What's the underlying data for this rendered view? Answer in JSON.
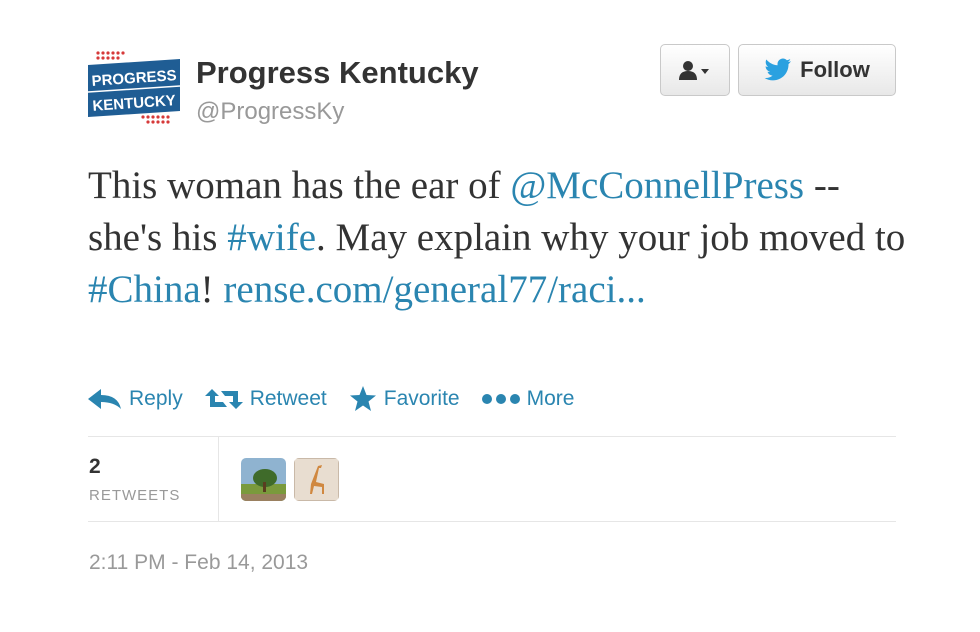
{
  "account": {
    "name": "Progress Kentucky",
    "screen_name": "@ProgressKy",
    "logo_text": [
      "PROGRESS",
      "KENTUCKY"
    ]
  },
  "buttons": {
    "follow_label": "Follow"
  },
  "tweet": {
    "segments": [
      {
        "text": "This woman has the ear of ",
        "type": "text"
      },
      {
        "text": "@McConnellPress",
        "type": "mention"
      },
      {
        "text": " -- she's his ",
        "type": "text"
      },
      {
        "text": "#wife",
        "type": "hashtag"
      },
      {
        "text": ". May explain why your job moved to ",
        "type": "text"
      },
      {
        "text": "#China",
        "type": "hashtag"
      },
      {
        "text": "! ",
        "type": "text"
      },
      {
        "text": "rense.com/general77/raci...",
        "type": "url"
      }
    ]
  },
  "actions": [
    {
      "label": "Reply",
      "icon": "reply-icon"
    },
    {
      "label": "Retweet",
      "icon": "retweet-icon"
    },
    {
      "label": "Favorite",
      "icon": "star-icon"
    },
    {
      "label": "More",
      "icon": "more-dots-icon"
    }
  ],
  "stats": {
    "retweets_count": "2",
    "retweets_label": "RETWEETS"
  },
  "timestamp": "2:11 PM - Feb 14, 2013",
  "colors": {
    "link": "#2a85b0",
    "logo_blue": "#1f5d94",
    "logo_red": "#d63a3a"
  }
}
